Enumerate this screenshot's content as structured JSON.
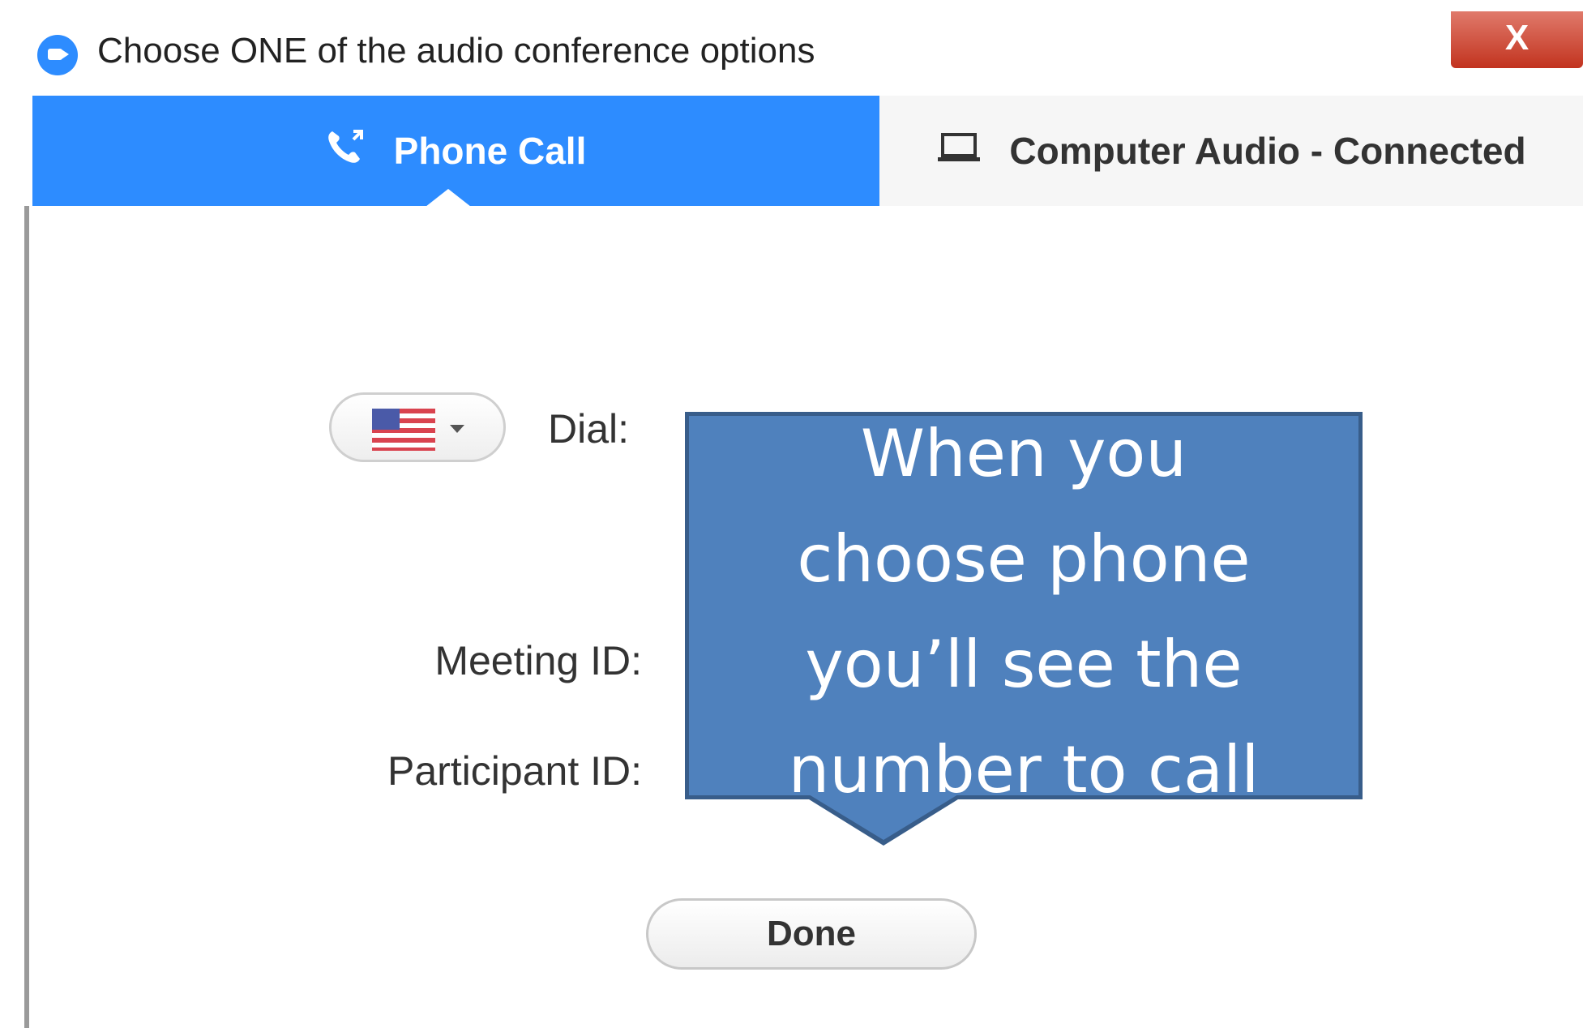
{
  "window": {
    "title": "Choose ONE of the audio conference options",
    "close_label": "X"
  },
  "tabs": [
    {
      "label": "Phone Call",
      "icon": "phone-icon",
      "selected": true
    },
    {
      "label": "Computer Audio - Connected",
      "icon": "laptop-icon",
      "selected": false
    }
  ],
  "form": {
    "country_flag": "us-flag-icon",
    "dial_label": "Dial:",
    "meeting_id_label": "Meeting ID:",
    "participant_id_label": "Participant ID:"
  },
  "callout": {
    "lines": [
      "When you",
      "choose phone",
      "you’ll see the",
      "number to call"
    ]
  },
  "buttons": {
    "done_label": "Done"
  },
  "colors": {
    "accent": "#2d8cff",
    "callout_fill": "#4f81bd",
    "callout_border": "#385d8a",
    "close_red": "#c2331f"
  }
}
